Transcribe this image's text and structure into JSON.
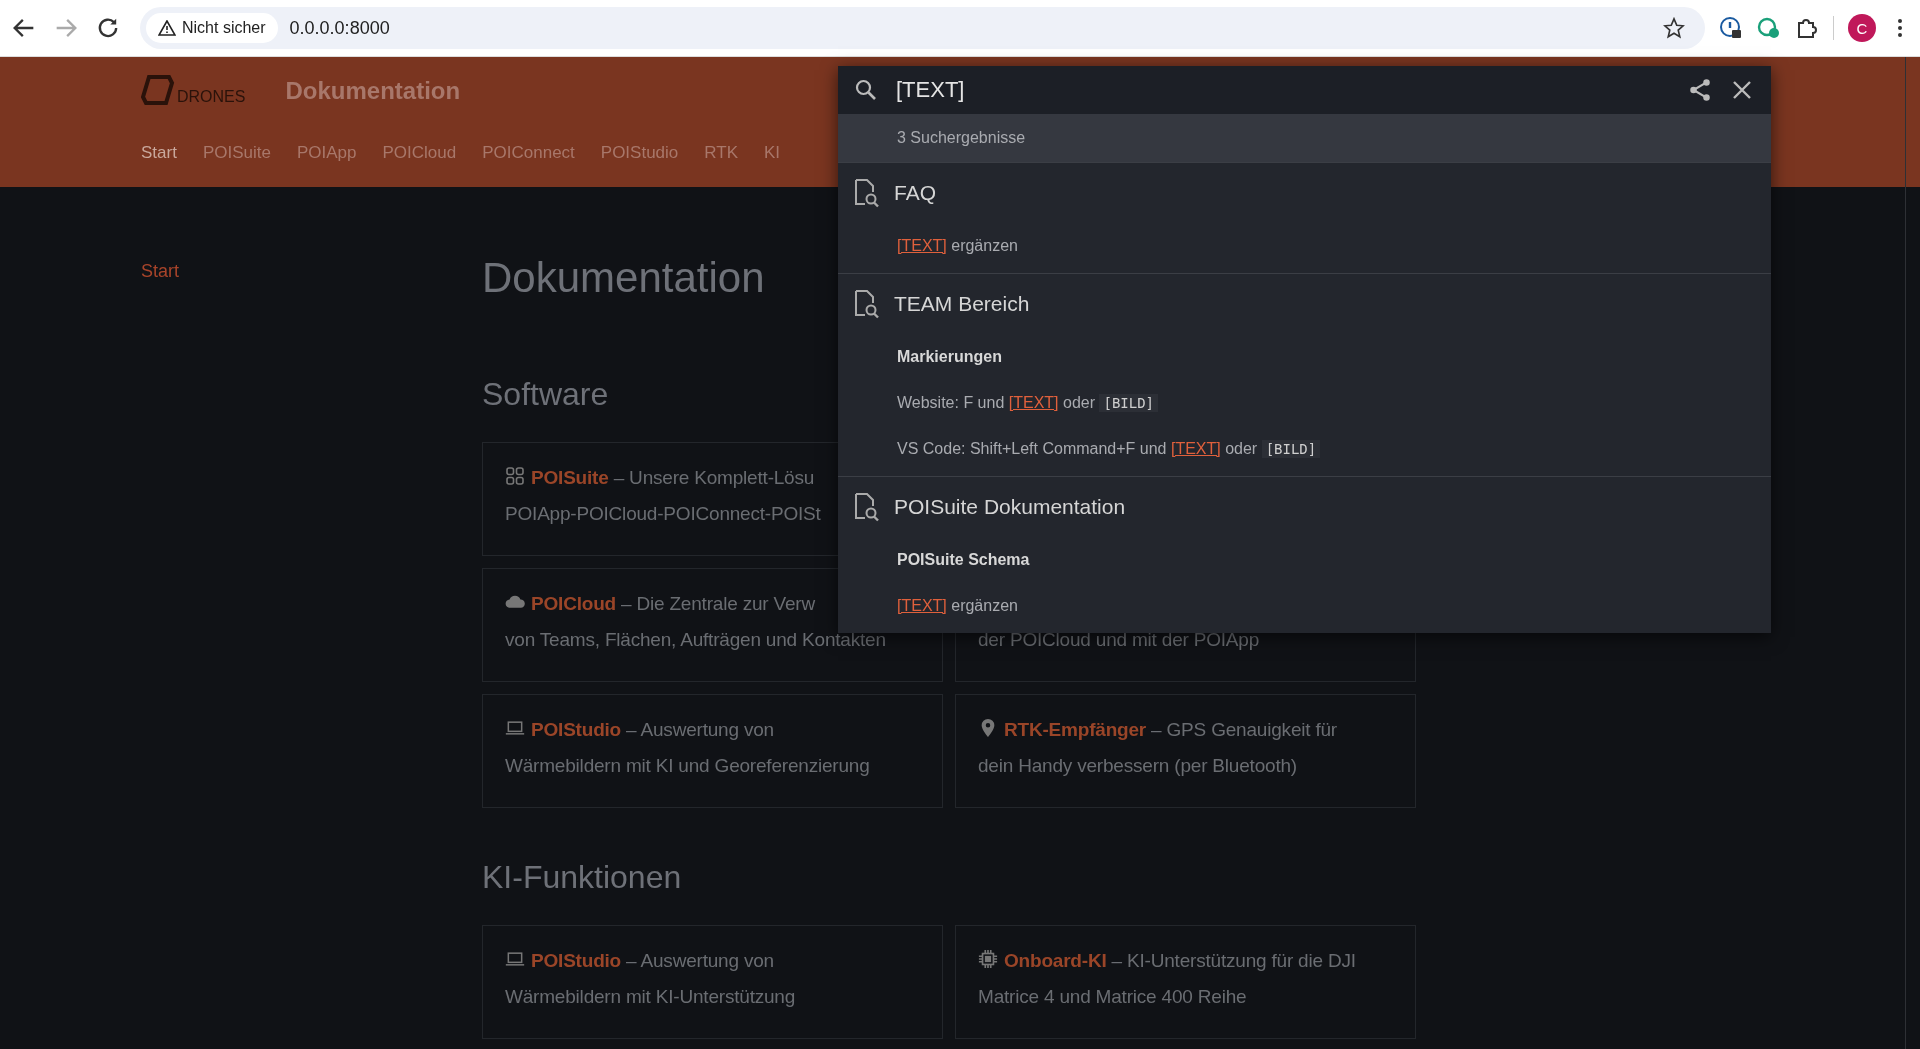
{
  "browser": {
    "security": "Nicht sicher",
    "url": "0.0.0.0:8000",
    "avatar": "C"
  },
  "header": {
    "logo": "DRONES",
    "title": "Dokumentation",
    "nav": [
      {
        "label": "Start",
        "selected": true
      },
      {
        "label": "POISuite",
        "selected": false
      },
      {
        "label": "POIApp",
        "selected": false
      },
      {
        "label": "POICloud",
        "selected": false
      },
      {
        "label": "POIConnect",
        "selected": false
      },
      {
        "label": "POIStudio",
        "selected": false
      },
      {
        "label": "RTK",
        "selected": false
      },
      {
        "label": "KI",
        "selected": false
      }
    ]
  },
  "sidebar": {
    "items": [
      {
        "label": "Start",
        "selected": true
      }
    ]
  },
  "main": {
    "title": "Dokumentation",
    "sections": [
      {
        "title": "Software",
        "rows": [
          [
            {
              "kind": "grid",
              "title": "POISuite",
              "line_1": " – Unsere Komplett-Lösu",
              "line_2": "POIApp-POICloud-POIConnect-POISt"
            }
          ],
          [
            {
              "kind": "cloud",
              "title": "POICloud",
              "line_1": " – Die Zentrale zur Verw",
              "line_2": "von Teams, Flächen, Aufträgen und Kontakten"
            },
            {
              "line_2": "der POICloud und mit der POIApp"
            }
          ],
          [
            {
              "kind": "laptop",
              "title": "POIStudio",
              "line_1": " – Auswertung von",
              "line_2": "Wärmebildern mit KI und Georeferenzierung"
            },
            {
              "kind": "pin",
              "title": "RTK-Empfänger",
              "line_1": " – GPS Genauigkeit für",
              "line_2": "dein Handy verbessern (per Bluetooth)"
            }
          ]
        ]
      },
      {
        "title": "KI-Funktionen",
        "rows": [
          [
            {
              "kind": "laptop",
              "title": "POIStudio",
              "line_1": " – Auswertung von",
              "line_2": "Wärmebildern mit KI-Unterstützung"
            },
            {
              "kind": "chip",
              "title": "Onboard-KI",
              "line_1": " – KI-Unterstützung für die DJI",
              "line_2": "Matrice 4 und Matrice 400 Reihe"
            }
          ]
        ]
      }
    ]
  },
  "search": {
    "value": "[TEXT]",
    "count": "3 Suchergebnisse",
    "results": [
      {
        "title": "FAQ",
        "items": [
          {
            "kind": "text",
            "parts": [
              {
                "kind": "mark",
                "text": "[TEXT]"
              },
              {
                "kind": "plain",
                "text": " ergänzen"
              }
            ]
          }
        ]
      },
      {
        "title": "TEAM Bereich",
        "items": [
          {
            "kind": "heading",
            "parts": [
              {
                "kind": "plain",
                "text": "Markierungen"
              }
            ]
          },
          {
            "kind": "text",
            "parts": [
              {
                "kind": "plain",
                "text": "Website: F und "
              },
              {
                "kind": "mark",
                "text": "[TEXT]"
              },
              {
                "kind": "plain",
                "text": " oder "
              },
              {
                "kind": "code",
                "text": "[BILD]"
              }
            ]
          },
          {
            "kind": "text",
            "parts": [
              {
                "kind": "plain",
                "text": "VS Code: Shift+Left Command+F und "
              },
              {
                "kind": "mark",
                "text": "[TEXT]"
              },
              {
                "kind": "plain",
                "text": " oder "
              },
              {
                "kind": "code",
                "text": "[BILD]"
              }
            ]
          }
        ]
      },
      {
        "title": "POISuite Dokumentation",
        "items": [
          {
            "kind": "heading",
            "parts": [
              {
                "kind": "plain",
                "text": "POISuite Schema"
              }
            ]
          },
          {
            "kind": "text",
            "parts": [
              {
                "kind": "mark",
                "text": "[TEXT]"
              },
              {
                "kind": "plain",
                "text": " ergänzen"
              }
            ]
          }
        ]
      }
    ]
  }
}
